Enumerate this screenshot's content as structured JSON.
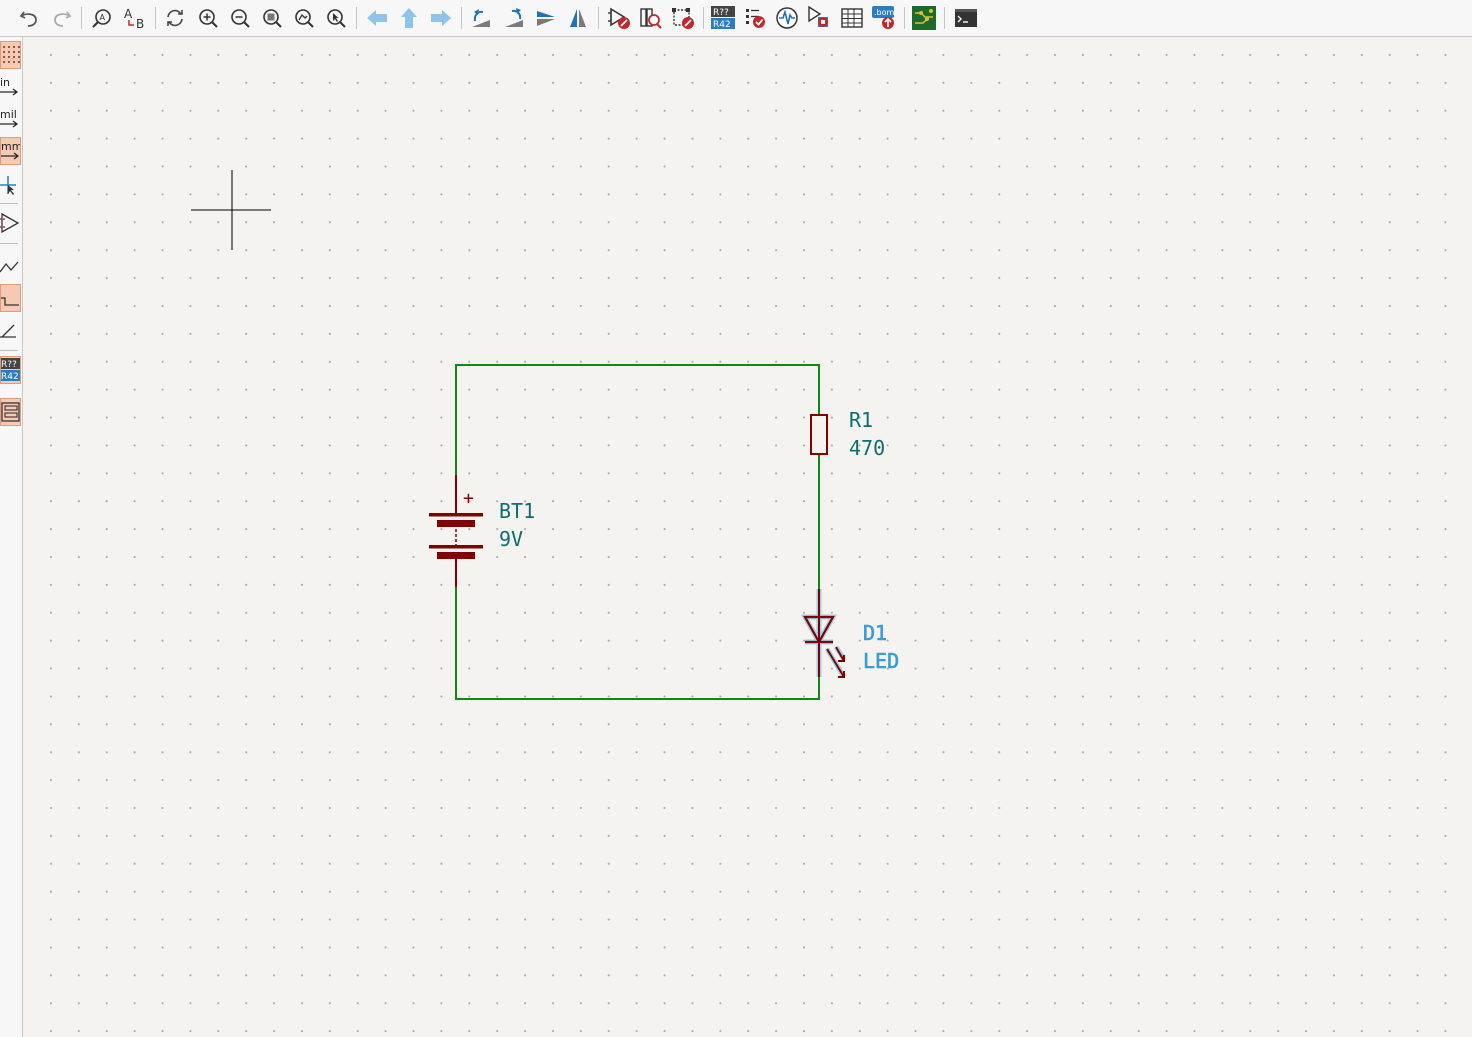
{
  "toolbar": {
    "buttons": [
      {
        "name": "undo-button",
        "icon": "undo-icon"
      },
      {
        "name": "redo-button",
        "icon": "redo-icon"
      },
      {
        "name": "find-button",
        "icon": "find-icon"
      },
      {
        "name": "find-replace-button",
        "icon": "find-replace-icon"
      },
      {
        "name": "refresh-button",
        "icon": "refresh-icon"
      },
      {
        "name": "zoom-in-button",
        "icon": "zoom-in-icon"
      },
      {
        "name": "zoom-out-button",
        "icon": "zoom-out-icon"
      },
      {
        "name": "zoom-fit-button",
        "icon": "zoom-fit-icon"
      },
      {
        "name": "zoom-objects-button",
        "icon": "zoom-objects-icon"
      },
      {
        "name": "zoom-selection-button",
        "icon": "zoom-selection-icon"
      },
      {
        "name": "back-button",
        "icon": "arrow-left-icon"
      },
      {
        "name": "up-button",
        "icon": "arrow-up-icon"
      },
      {
        "name": "forward-button",
        "icon": "arrow-right-icon"
      },
      {
        "name": "rotate-ccw-button",
        "icon": "rotate-ccw-icon"
      },
      {
        "name": "rotate-cw-button",
        "icon": "rotate-cw-icon"
      },
      {
        "name": "mirror-v-button",
        "icon": "mirror-vertical-icon"
      },
      {
        "name": "mirror-h-button",
        "icon": "mirror-horizontal-icon"
      },
      {
        "name": "symbol-editor-button",
        "icon": "symbol-editor-icon"
      },
      {
        "name": "symbol-browser-button",
        "icon": "symbol-browser-icon"
      },
      {
        "name": "footprint-editor-button",
        "icon": "footprint-editor-icon"
      },
      {
        "name": "annotate-button",
        "icon": "annotate-icon"
      },
      {
        "name": "erc-button",
        "icon": "erc-icon"
      },
      {
        "name": "simulator-button",
        "icon": "simulator-icon"
      },
      {
        "name": "assign-footprints-button",
        "icon": "assign-footprints-icon"
      },
      {
        "name": "symbol-fields-table-button",
        "icon": "table-icon"
      },
      {
        "name": "bom-button",
        "icon": "bom-icon"
      },
      {
        "name": "open-pcb-button",
        "icon": "pcb-icon"
      },
      {
        "name": "scripting-console-button",
        "icon": "console-icon"
      }
    ],
    "annotate_top": "R??",
    "annotate_bottom": "R42",
    "bom_label": ".bom"
  },
  "left_toolbar": {
    "units_in": "in",
    "units_mil": "mil",
    "units_mm": "mm",
    "annotate_top": "R??",
    "annotate_bottom": "R42"
  },
  "schematic": {
    "battery": {
      "ref": "BT1",
      "value": "9V",
      "polarity": "+"
    },
    "resistor": {
      "ref": "R1",
      "value": "470"
    },
    "led": {
      "ref": "D1",
      "value": "LED",
      "selected": true
    },
    "colors": {
      "wire": "#118811",
      "symbol": "#840000",
      "reference": "#0c6e6e",
      "selection": "#3a9cd4",
      "canvas": "#f4f3ef"
    }
  }
}
